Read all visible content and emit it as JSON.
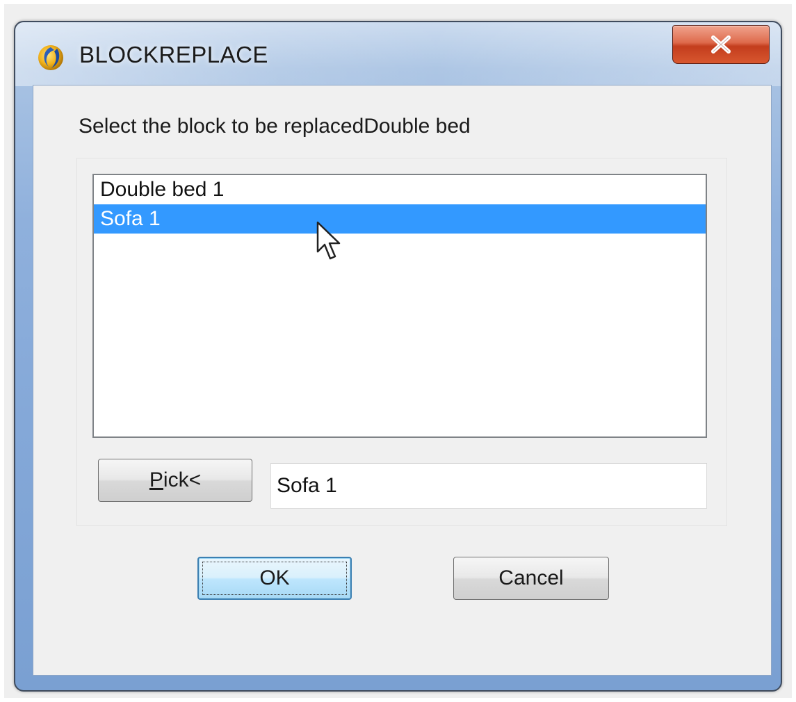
{
  "window": {
    "title": "BLOCKREPLACE",
    "app_icon": "drafting-app-icon",
    "close_label": "X"
  },
  "dialog": {
    "prompt": "Select the block to be replacedDouble bed",
    "blocks": [
      {
        "label": "Double bed 1",
        "selected": false
      },
      {
        "label": "Sofa 1",
        "selected": true
      }
    ],
    "pick_button": {
      "mnemonic": "P",
      "rest": "ick<"
    },
    "picked_value": "Sofa 1",
    "ok_label": "OK",
    "cancel_label": "Cancel"
  },
  "colors": {
    "selection": "#3399ff",
    "close_button": "#c94a2b",
    "window_frame": "#8fb0dc"
  }
}
